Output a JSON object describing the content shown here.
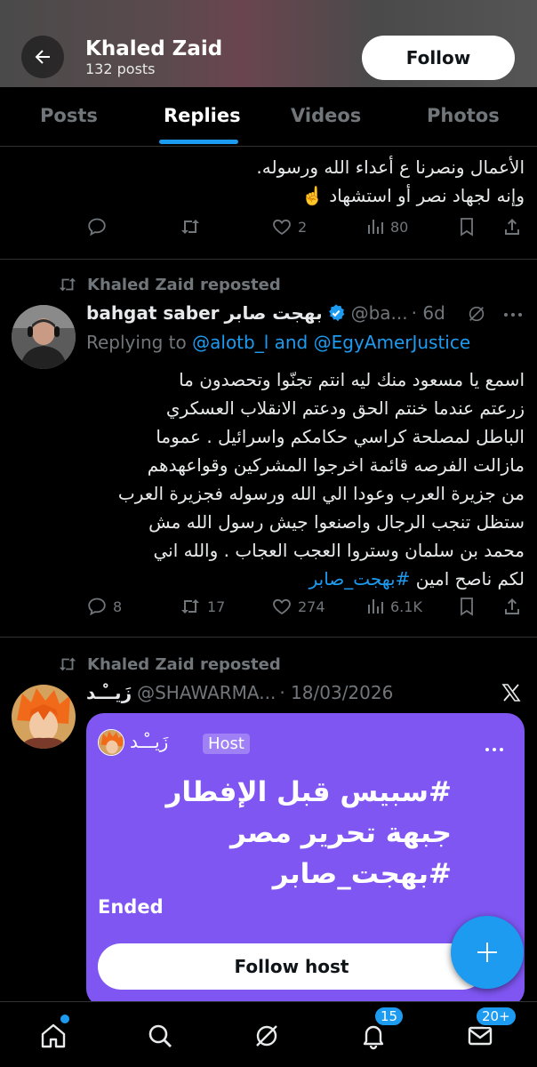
{
  "header": {
    "name": "Khaled Zaid",
    "posts": "132 posts",
    "follow_label": "Follow"
  },
  "tabs": [
    {
      "label": "Posts"
    },
    {
      "label": "Replies"
    },
    {
      "label": "Videos"
    },
    {
      "label": "Photos"
    }
  ],
  "tweet1": {
    "line1": "الأعمال ونصرنا ع أعداء الله ورسوله.",
    "line2": "وإنه لجهاد نصر أو استشهاد ☝️",
    "replies": "",
    "retweets": "",
    "likes": "2",
    "views": "80"
  },
  "tweet2": {
    "repost_label": "Khaled Zaid reposted",
    "name_en": "bahgat saber",
    "name_ar": "بهجت صابر",
    "handle": "@ba...",
    "time": "· 6d",
    "replying_prefix": "Replying to",
    "replying_to": "@alotb_l and @EgyAmerJustice",
    "text_lines": [
      "اسمع يا مسعود منك ليه انتم تجنّوا وتحصدون ما",
      "زرعتم عندما خنتم الحق ودعتم الانقلاب العسكري",
      "الباطل لمصلحة كراسي حكامكم واسرائيل . عموما",
      "مازالت الفرصه قائمة اخرجوا المشركين وقواعهدهم",
      "من جزيرة العرب وعودا الي الله ورسوله فجزيرة العرب",
      "ستظل تنجب الرجال واصنعوا جيش رسول الله مش",
      "محمد بن سلمان وستروا العجب العجاب . والله اني"
    ],
    "last_line_text": "لكم ناصح امين",
    "hashtag": "#بهجت_صابر",
    "replies": "8",
    "retweets": "17",
    "likes": "274",
    "views": "6.1K"
  },
  "tweet3": {
    "repost_label": "Khaled Zaid reposted",
    "name": "زَيــْـد",
    "handle": "@SHAWARMA...",
    "time": "· 18/03/2026",
    "space": {
      "host_name": "زَيــْـد",
      "host_badge": "Host",
      "title": "#سبيس قبل الإفطار جبهة تحرير مصر #بهجت_صابر",
      "status": "Ended",
      "follow_host_label": "Follow host"
    }
  },
  "bottom_nav": {
    "notifications_badge": "15",
    "messages_badge": "20+"
  },
  "colors": {
    "accent": "#1d9bf0",
    "space_purple": "#7f56f2",
    "muted": "#71767b",
    "background": "#000000"
  }
}
